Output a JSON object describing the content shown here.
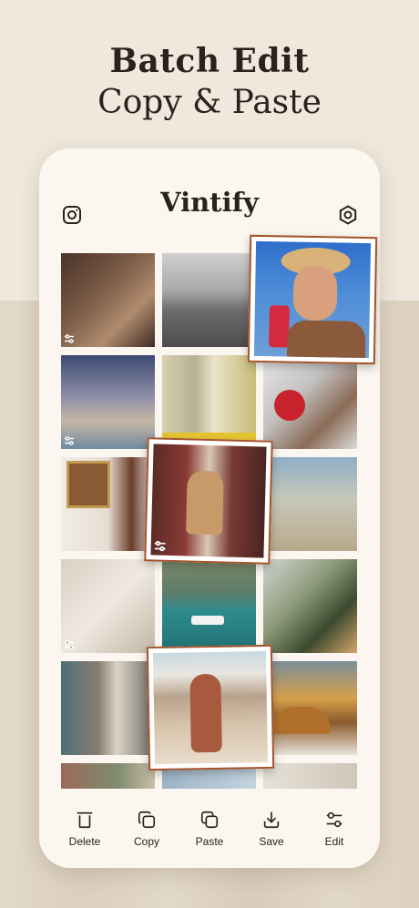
{
  "headline": {
    "line1": "Batch Edit",
    "line2": "Copy & Paste"
  },
  "app": {
    "title": "Vintify",
    "left_icon": "instagram-icon",
    "right_icon": "settings-icon"
  },
  "toolbar": {
    "items": [
      {
        "label": "Delete",
        "icon": "trash-icon"
      },
      {
        "label": "Copy",
        "icon": "copy-icon"
      },
      {
        "label": "Paste",
        "icon": "paste-icon"
      },
      {
        "label": "Save",
        "icon": "download-icon"
      },
      {
        "label": "Edit",
        "icon": "sliders-icon"
      }
    ]
  },
  "colors": {
    "background": "#efe8dc",
    "card": "#fbf7f0",
    "text": "#2a231d",
    "frame_border": "#a4532a"
  }
}
